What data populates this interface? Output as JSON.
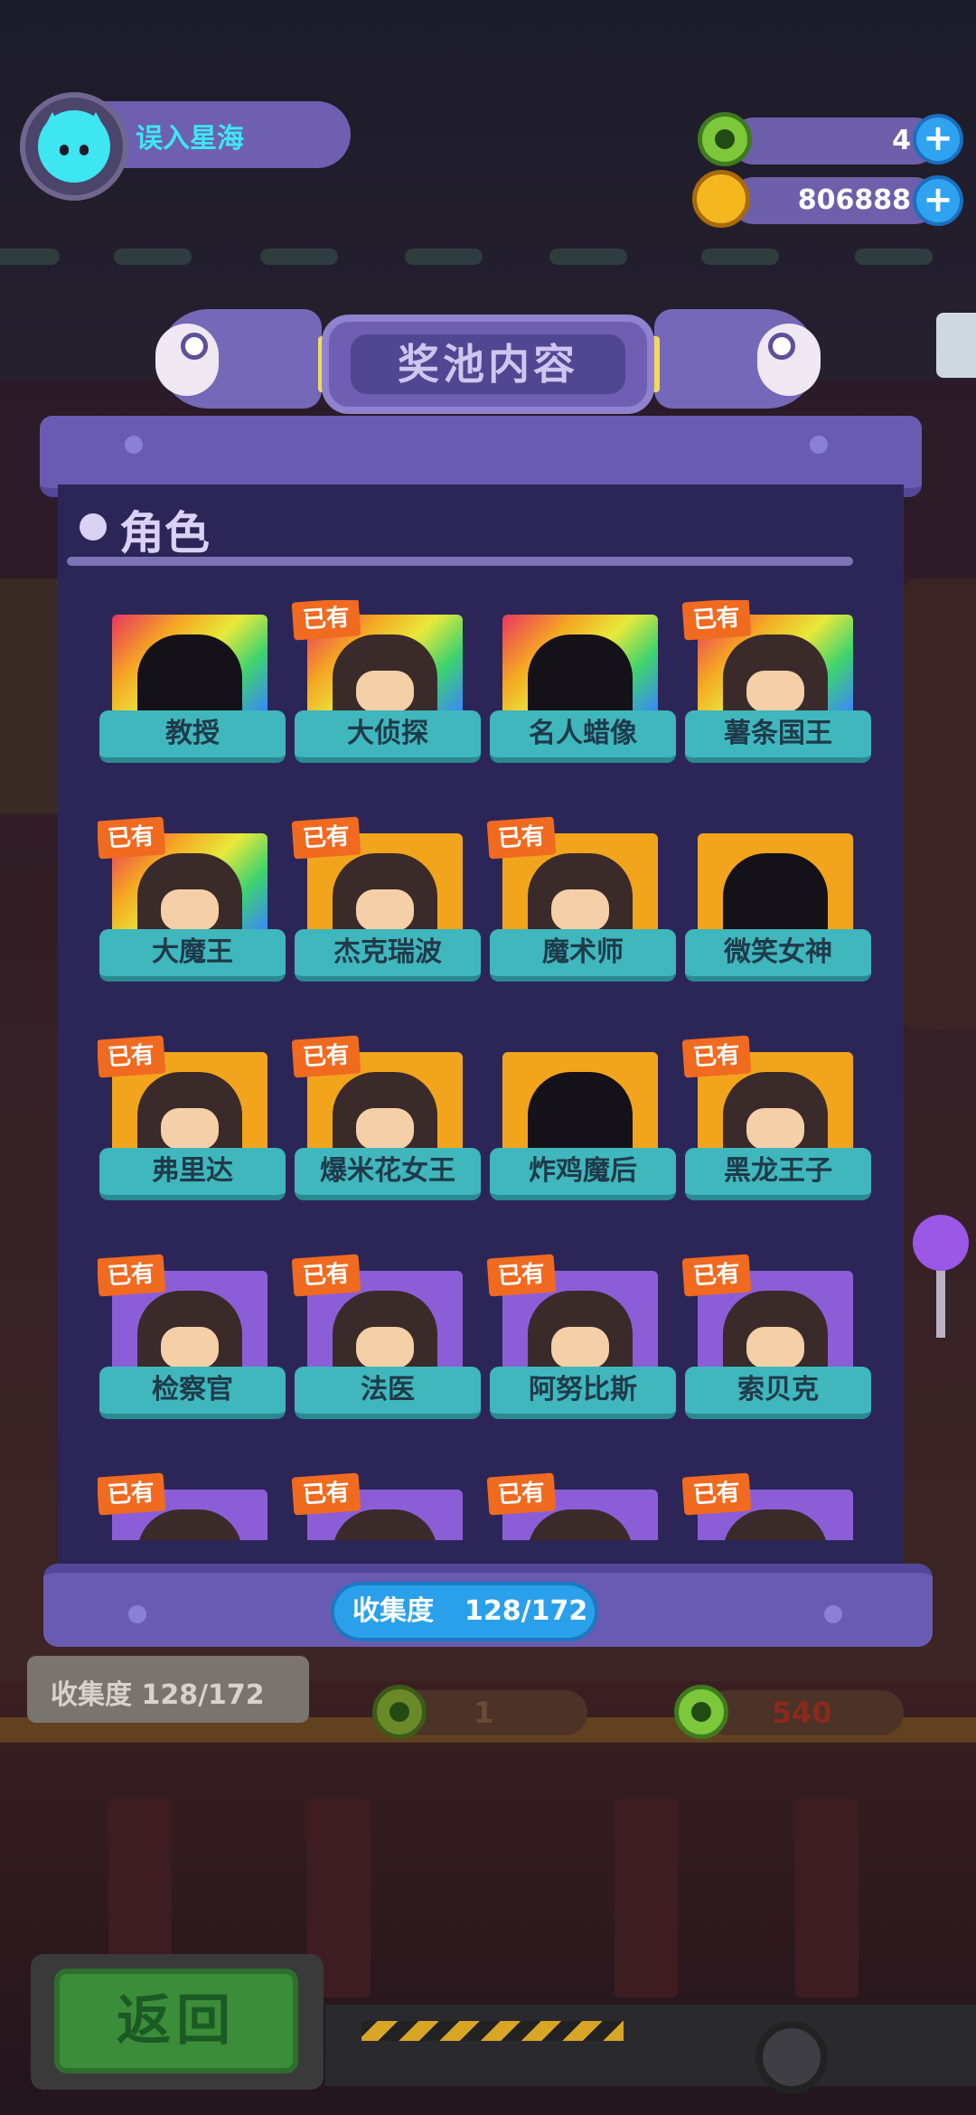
{
  "player": {
    "name": "误入星海",
    "avatar_icon": "cyan-cat-avatar"
  },
  "currency": {
    "gems": {
      "icon": "green-donut-coin",
      "value": "4"
    },
    "coins": {
      "icon": "gold-planet-coin",
      "value": "806888"
    }
  },
  "banner": {
    "title": "奖池内容"
  },
  "section": {
    "title": "角色"
  },
  "owned_label": "已有",
  "characters": [
    {
      "name": "教授",
      "owned": false,
      "rarity": "rainbow"
    },
    {
      "name": "大侦探",
      "owned": true,
      "rarity": "rainbow"
    },
    {
      "name": "名人蜡像",
      "owned": false,
      "rarity": "rainbow"
    },
    {
      "name": "薯条国王",
      "owned": true,
      "rarity": "rainbow"
    },
    {
      "name": "大魔王",
      "owned": true,
      "rarity": "rainbow"
    },
    {
      "name": "杰克瑞波",
      "owned": true,
      "rarity": "gold"
    },
    {
      "name": "魔术师",
      "owned": true,
      "rarity": "gold"
    },
    {
      "name": "微笑女神",
      "owned": false,
      "rarity": "gold"
    },
    {
      "name": "弗里达",
      "owned": true,
      "rarity": "gold"
    },
    {
      "name": "爆米花女王",
      "owned": true,
      "rarity": "gold"
    },
    {
      "name": "炸鸡魔后",
      "owned": false,
      "rarity": "gold"
    },
    {
      "name": "黑龙王子",
      "owned": true,
      "rarity": "gold"
    },
    {
      "name": "检察官",
      "owned": true,
      "rarity": "purple"
    },
    {
      "name": "法医",
      "owned": true,
      "rarity": "purple"
    },
    {
      "name": "阿努比斯",
      "owned": true,
      "rarity": "purple"
    },
    {
      "name": "索贝克",
      "owned": true,
      "rarity": "purple"
    },
    {
      "name": "",
      "owned": true,
      "rarity": "purple"
    },
    {
      "name": "",
      "owned": true,
      "rarity": "purple"
    },
    {
      "name": "",
      "owned": true,
      "rarity": "purple"
    },
    {
      "name": "",
      "owned": true,
      "rarity": "purple"
    }
  ],
  "collection": {
    "label": "收集度",
    "value": "128/172"
  },
  "background": {
    "collection_text": "收集度 128/172",
    "slot_1": "1",
    "slot_2": "540"
  },
  "back_button": {
    "label": "返回"
  },
  "colors": {
    "rainbow_tier": "#e9365f",
    "gold_tier": "#f2a51c",
    "purple_tier": "#8b5ed8",
    "name_bar": "#3fb7bd",
    "owned_badge": "#f06a20",
    "panel": "#2c2658",
    "collect_pill": "#2aa0ea"
  }
}
